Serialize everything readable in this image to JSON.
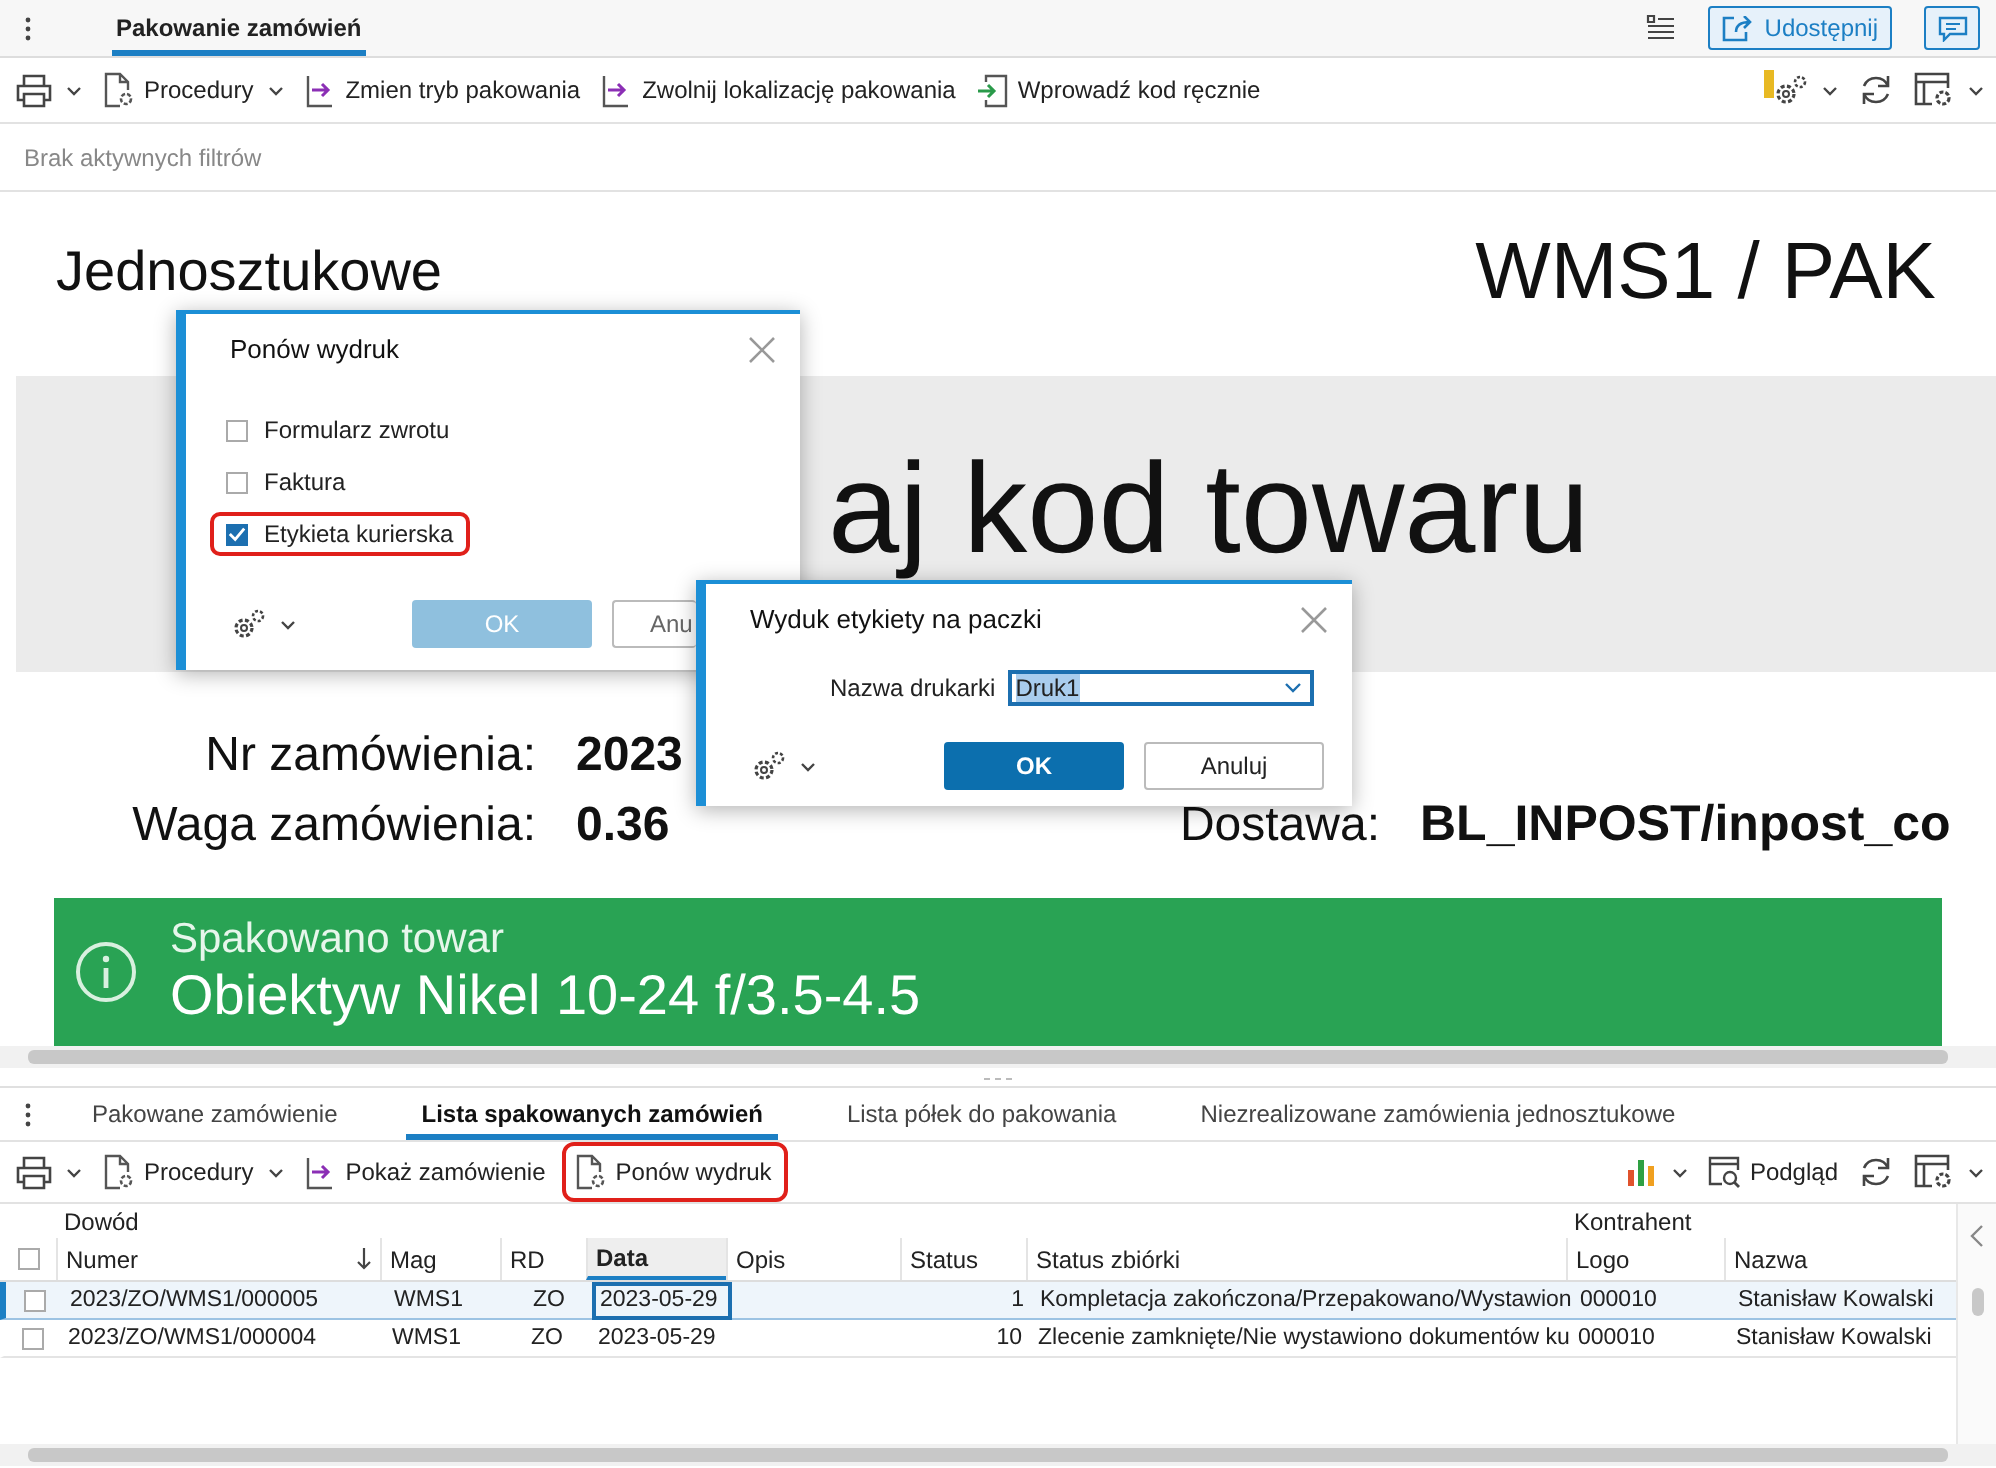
{
  "top_tabs": [
    {
      "label": "Pakowanie zamówień",
      "selected": true
    }
  ],
  "share_button": "Udostępnij",
  "toolbar": [
    {
      "kind": "procedures",
      "label": "Procedury"
    },
    {
      "kind": "arrow",
      "label": "Zmien tryb pakowania"
    },
    {
      "kind": "arrow",
      "label": "Zwolnij lokalizację pakowania"
    },
    {
      "kind": "enter",
      "label": "Wprowadź kod ręcznie"
    }
  ],
  "filters": "Brak aktywnych filtrów",
  "title": "Jednosztukowe",
  "station": "WMS1 / PAK",
  "scan_banner": "aj kod towaru",
  "order_no": {
    "label": "Nr zamówienia:",
    "value": "2023"
  },
  "weight": {
    "label": "Waga zamówienia:",
    "value": "0.36"
  },
  "delivery": {
    "label": "Dostawa:",
    "value": "BL_INPOST/inpost_co"
  },
  "message": {
    "title": "Spakowano towar",
    "text": "Obiektyw Nikel 10-24 f/3.5-4.5"
  },
  "reprint_dialog": {
    "title": "Ponów wydruk",
    "options": [
      {
        "label": "Formularz zwrotu",
        "checked": false,
        "highlighted": false
      },
      {
        "label": "Faktura",
        "checked": false,
        "highlighted": false
      },
      {
        "label": "Etykieta kurierska",
        "checked": true,
        "highlighted": true
      }
    ],
    "ok": {
      "label": "OK",
      "disabled": true
    },
    "cancel": "Anu"
  },
  "label_dialog": {
    "title": "Wyduk etykiety na paczki",
    "field_label": "Nazwa drukarki",
    "printer": "Druk1",
    "ok": "OK",
    "cancel": "Anuluj"
  },
  "bottom_tabs": [
    {
      "label": "Pakowane zamówienie",
      "selected": false
    },
    {
      "label": "Lista spakowanych zamówień",
      "selected": true
    },
    {
      "label": "Lista półek do pakowania",
      "selected": false
    },
    {
      "label": "Niezrealizowane zamówienia jednosztukowe",
      "selected": false
    }
  ],
  "bottom_toolbar": [
    {
      "kind": "procedures",
      "label": "Procedury",
      "highlighted": false
    },
    {
      "kind": "arrow",
      "label": "Pokaż zamówienie",
      "highlighted": false
    },
    {
      "kind": "doc",
      "label": "Ponów wydruk",
      "highlighted": true
    }
  ],
  "preview_button": "Podgląd",
  "table": {
    "groups": [
      "Dowód",
      "Kontrahent"
    ],
    "select_all_checked": false,
    "columns": [
      {
        "label": "Numer",
        "sorted": true,
        "active": false
      },
      {
        "label": "Mag",
        "sorted": false,
        "active": false
      },
      {
        "label": "RD",
        "sorted": false,
        "active": false
      },
      {
        "label": "Data",
        "sorted": false,
        "active": true
      },
      {
        "label": "Opis",
        "sorted": false,
        "active": false
      },
      {
        "label": "Status",
        "sorted": false,
        "active": false
      },
      {
        "label": "Status zbiórki",
        "sorted": false,
        "active": false
      },
      {
        "label": "Logo",
        "sorted": false,
        "active": false
      },
      {
        "label": "Nazwa",
        "sorted": false,
        "active": false
      }
    ],
    "rows": [
      {
        "selected": true,
        "checked": false,
        "cells": [
          "2023/ZO/WMS1/000005",
          "WMS1",
          "ZO",
          "2023-05-29",
          "",
          "1",
          "Kompletacja zakończona/Przepakowano/Wystawion",
          "000010",
          "Stanisław Kowalski"
        ]
      },
      {
        "selected": false,
        "checked": false,
        "cells": [
          "2023/ZO/WMS1/000004",
          "WMS1",
          "ZO",
          "2023-05-29",
          "",
          "10",
          "Zlecenie zamknięte/Nie wystawiono dokumentów ku",
          "000010",
          "Stanisław Kowalski"
        ]
      }
    ]
  }
}
